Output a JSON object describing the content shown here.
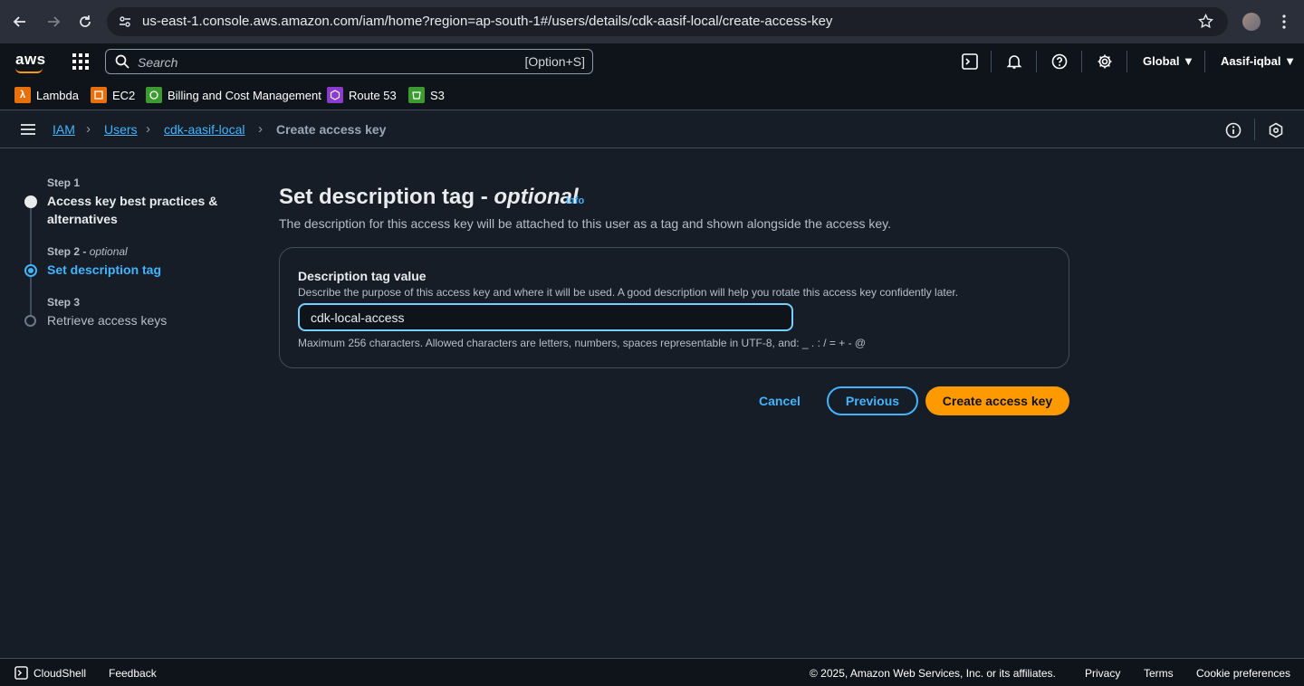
{
  "browser": {
    "url": "us-east-1.console.aws.amazon.com/iam/home?region=ap-south-1#/users/details/cdk-aasif-local/create-access-key"
  },
  "topnav": {
    "logo": "aws",
    "search_placeholder": "Search",
    "search_shortcut": "[Option+S]",
    "region": "Global ▼",
    "user": "Aasif-iqbal ▼"
  },
  "favorites": [
    {
      "label": "Lambda",
      "color": "#e7700d"
    },
    {
      "label": "EC2",
      "color": "#e7700d"
    },
    {
      "label": "Billing and Cost Management",
      "color": "#3b9b2e"
    },
    {
      "label": "Route 53",
      "color": "#8c3bd1"
    },
    {
      "label": "S3",
      "color": "#3b9b2e"
    }
  ],
  "breadcrumb": {
    "items": [
      "IAM",
      "Users",
      "cdk-aasif-local"
    ],
    "current": "Create access key"
  },
  "steps": [
    {
      "label": "Step 1",
      "title": "Access key best practices & alternatives",
      "state": "completed"
    },
    {
      "label": "Step 2",
      "optional": "optional",
      "title": "Set description tag",
      "state": "current"
    },
    {
      "label": "Step 3",
      "title": "Retrieve access keys",
      "state": "pending"
    }
  ],
  "main": {
    "title": "Set description tag - ",
    "title_optional": "optional",
    "info": "Info",
    "description": "The description for this access key will be attached to this user as a tag and shown alongside the access key.",
    "field_label": "Description tag value",
    "field_description": "Describe the purpose of this access key and where it will be used. A good description will help you rotate this access key confidently later.",
    "field_value": "cdk-local-access",
    "field_hint": "Maximum 256 characters. Allowed characters are letters, numbers, spaces representable in UTF-8, and: _ . : / = + - @"
  },
  "actions": {
    "cancel": "Cancel",
    "previous": "Previous",
    "create": "Create access key"
  },
  "footer": {
    "cloudshell": "CloudShell",
    "feedback": "Feedback",
    "copyright": "© 2025, Amazon Web Services, Inc. or its affiliates.",
    "privacy": "Privacy",
    "terms": "Terms",
    "cookies": "Cookie preferences"
  },
  "colors": {
    "accent": "#42b4ff",
    "primary_button": "#ff9900",
    "background": "#161d26"
  }
}
